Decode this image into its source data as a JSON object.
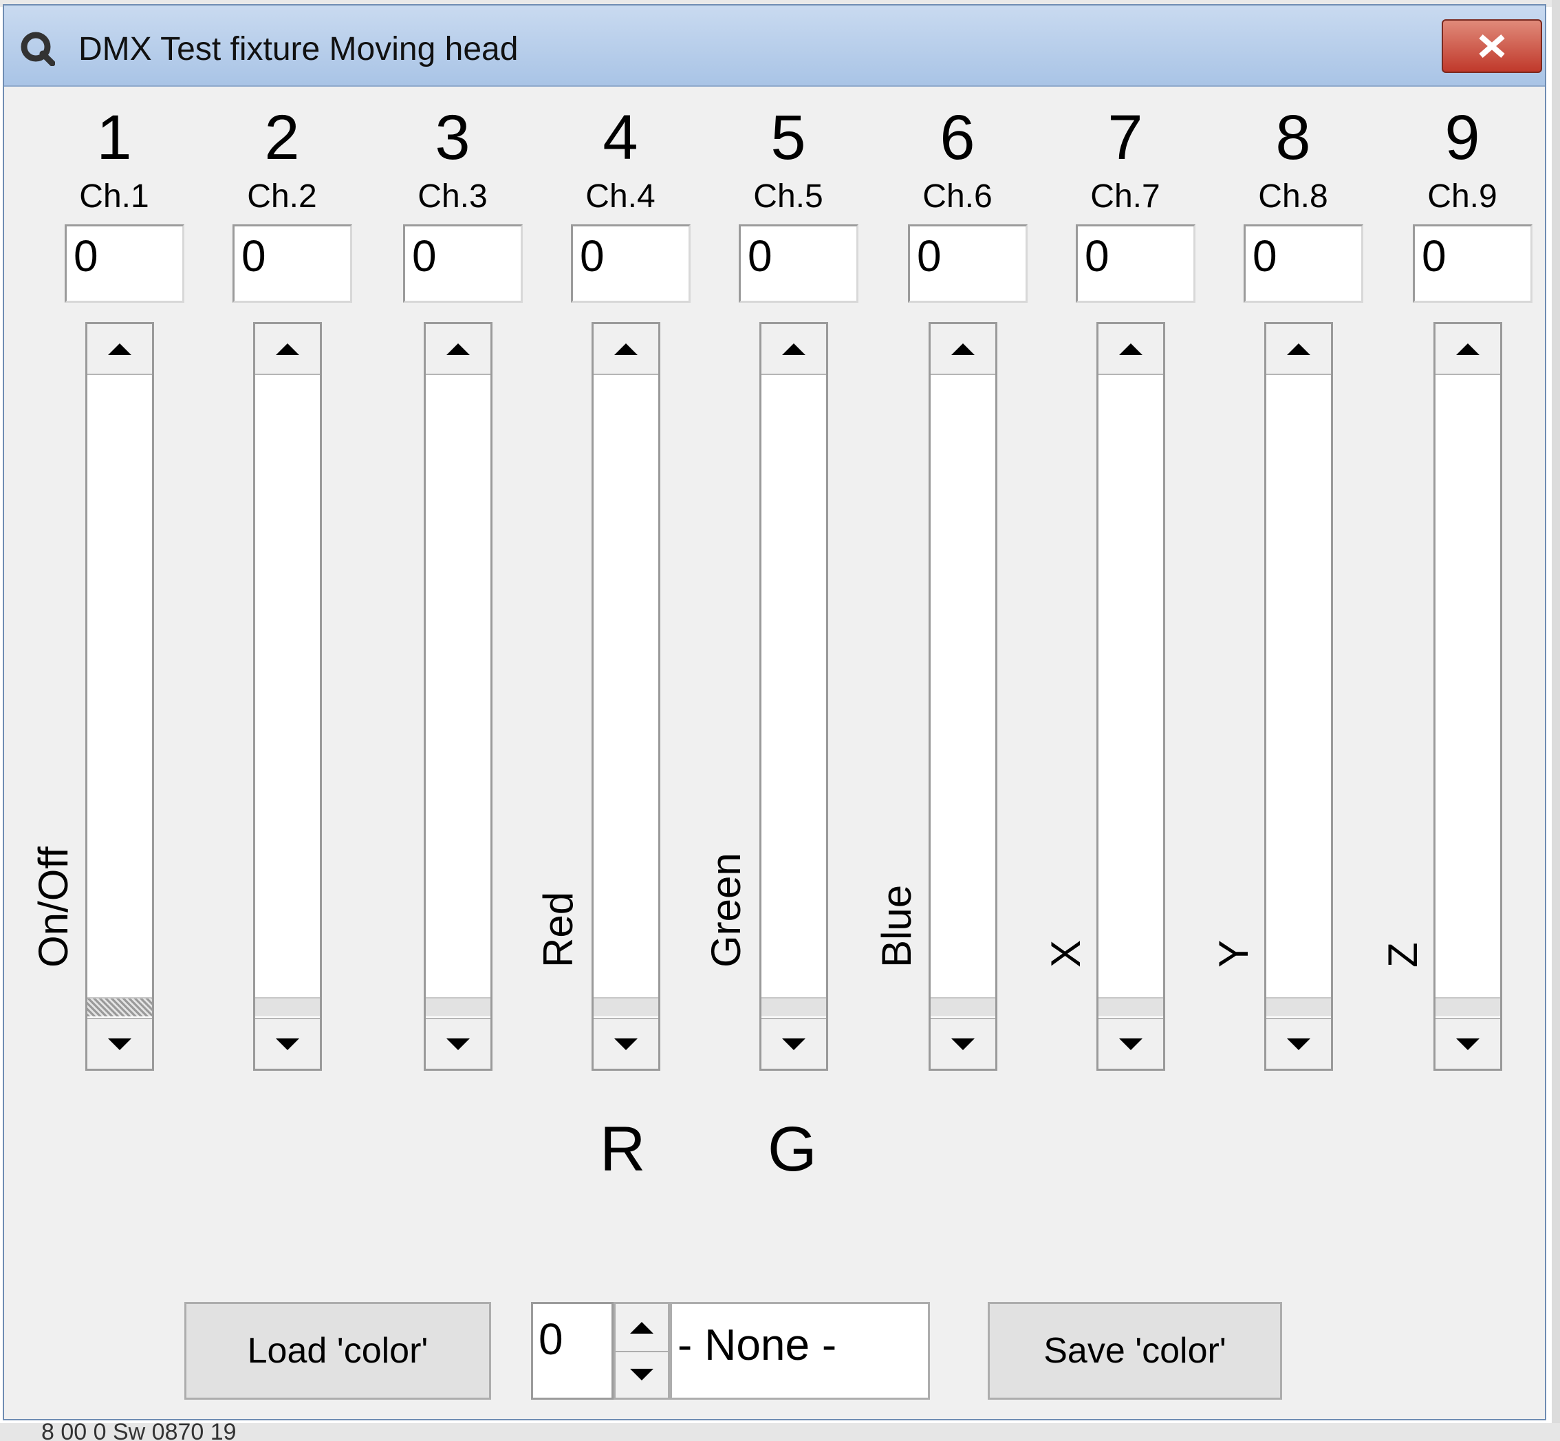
{
  "window": {
    "title": "DMX Test fixture Moving head"
  },
  "channels": [
    {
      "number": "1",
      "label": "Ch.1",
      "value": "0",
      "name": "On/Off"
    },
    {
      "number": "2",
      "label": "Ch.2",
      "value": "0",
      "name": ""
    },
    {
      "number": "3",
      "label": "Ch.3",
      "value": "0",
      "name": ""
    },
    {
      "number": "4",
      "label": "Ch.4",
      "value": "0",
      "name": "Red"
    },
    {
      "number": "5",
      "label": "Ch.5",
      "value": "0",
      "name": "Green"
    },
    {
      "number": "6",
      "label": "Ch.6",
      "value": "0",
      "name": "Blue"
    },
    {
      "number": "7",
      "label": "Ch.7",
      "value": "0",
      "name": "X"
    },
    {
      "number": "8",
      "label": "Ch.8",
      "value": "0",
      "name": "Y"
    },
    {
      "number": "9",
      "label": "Ch.9",
      "value": "0",
      "name": "Z"
    }
  ],
  "letters": {
    "r": "R",
    "g": "G"
  },
  "bottom": {
    "load_label": "Load 'color'",
    "save_label": "Save 'color'",
    "color_index": "0",
    "color_name": "- None -"
  },
  "background": {
    "status_fragment": "8 00 0 Sw 0870 19"
  },
  "icons": {
    "app": "qlc-app-icon",
    "close": "close-icon"
  },
  "colors": {
    "title_bar": "#b8cfea",
    "close_button": "#c8473a",
    "window_bg": "#f0f0f0"
  }
}
